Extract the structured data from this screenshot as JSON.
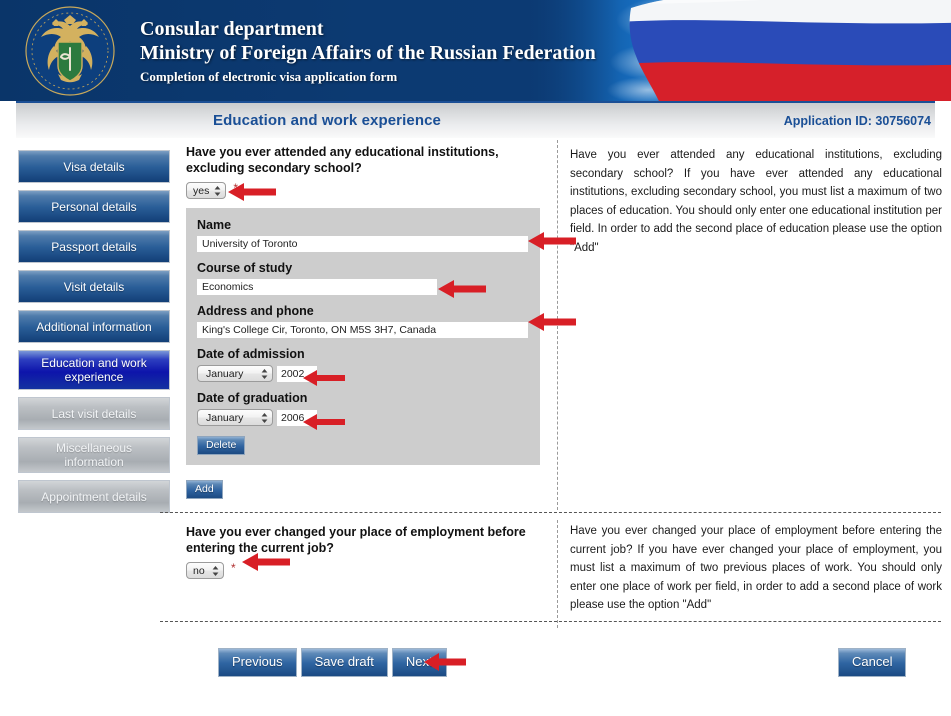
{
  "banner": {
    "line1": "Consular department",
    "line2": "Ministry of Foreign Affairs of the Russian Federation",
    "line3": "Completion of electronic visa application form",
    "emblem_alt": "russian-mfa-emblem"
  },
  "titlebar": {
    "page_title": "Education and work experience",
    "application_id": "Application ID: 30756074",
    "accent_color": "#1a4f96"
  },
  "sidebar": {
    "items": [
      {
        "label": "Visa details",
        "state": "enabled"
      },
      {
        "label": "Personal details",
        "state": "enabled"
      },
      {
        "label": "Passport details",
        "state": "enabled"
      },
      {
        "label": "Visit details",
        "state": "enabled"
      },
      {
        "label": "Additional information",
        "state": "enabled"
      },
      {
        "label": "Education and work experience",
        "state": "active"
      },
      {
        "label": "Last visit details",
        "state": "disabled"
      },
      {
        "label": "Miscellaneous information",
        "state": "disabled"
      },
      {
        "label": "Appointment details",
        "state": "disabled"
      }
    ]
  },
  "question1": {
    "label": "Have you ever attended any educational institutions, excluding secondary school?",
    "select_value": "yes",
    "required_marker": "*",
    "help": "Have you ever attended any educational institutions, excluding secondary school? If you have ever attended any educational institutions, excluding secondary school, you must list a maximum of two places of education. You should only enter one educational institution per field. In order to add the second place of education please use the option \"Add\"",
    "education": {
      "name_label": "Name",
      "name_value": "University of Toronto",
      "course_label": "Course of study",
      "course_value": "Economics",
      "address_label": "Address and phone",
      "address_value": "King's College Cir, Toronto, ON M5S 3H7, Canada",
      "admission_label": "Date of admission",
      "admission_month": "January",
      "admission_year": "2002",
      "graduation_label": "Date of graduation",
      "graduation_month": "January",
      "graduation_year": "2006",
      "delete_label": "Delete"
    },
    "add_label": "Add"
  },
  "question2": {
    "label": "Have you ever changed your place of employment before entering the current job?",
    "select_value": "no",
    "required_marker": "*",
    "help": "Have you ever changed your place of employment before entering the current job? If you have ever changed your place of employment, you must list a maximum of two previous places of work. You should only enter one place of work per field, in order to add a second place of work please use the option \"Add\""
  },
  "footer": {
    "previous_label": "Previous",
    "save_draft_label": "Save draft",
    "next_label": "Next",
    "cancel_label": "Cancel"
  },
  "annotations": {
    "arrow_color": "#d81f26",
    "count": 8
  }
}
